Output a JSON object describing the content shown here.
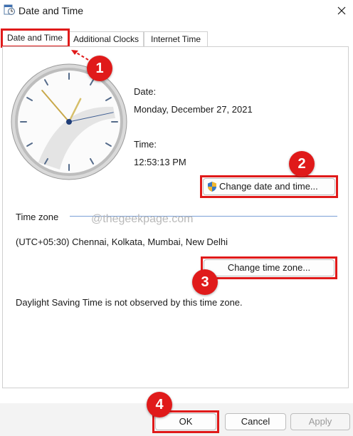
{
  "window": {
    "title": "Date and Time"
  },
  "tabs": [
    "Date and Time",
    "Additional Clocks",
    "Internet Time"
  ],
  "date": {
    "label": "Date:",
    "value": "Monday, December 27, 2021"
  },
  "time": {
    "label": "Time:",
    "value": "12:53:13 PM"
  },
  "buttons": {
    "change_date_time": "Change date and time...",
    "change_time_zone": "Change time zone...",
    "ok": "OK",
    "cancel": "Cancel",
    "apply": "Apply"
  },
  "timezone": {
    "section_label": "Time zone",
    "value": "(UTC+05:30) Chennai, Kolkata, Mumbai, New Delhi"
  },
  "dst_note": "Daylight Saving Time is not observed by this time zone.",
  "watermark": "@thegeekpage.com",
  "annotations": [
    "1",
    "2",
    "3",
    "4"
  ],
  "clock": {
    "hours": 12,
    "minutes": 53,
    "seconds": 13
  },
  "colors": {
    "highlight": "#e01a1a",
    "accent": "#0067c0"
  },
  "icons": {
    "app": "calendar-clock-icon",
    "close": "close-icon",
    "uac": "uac-shield-icon"
  }
}
